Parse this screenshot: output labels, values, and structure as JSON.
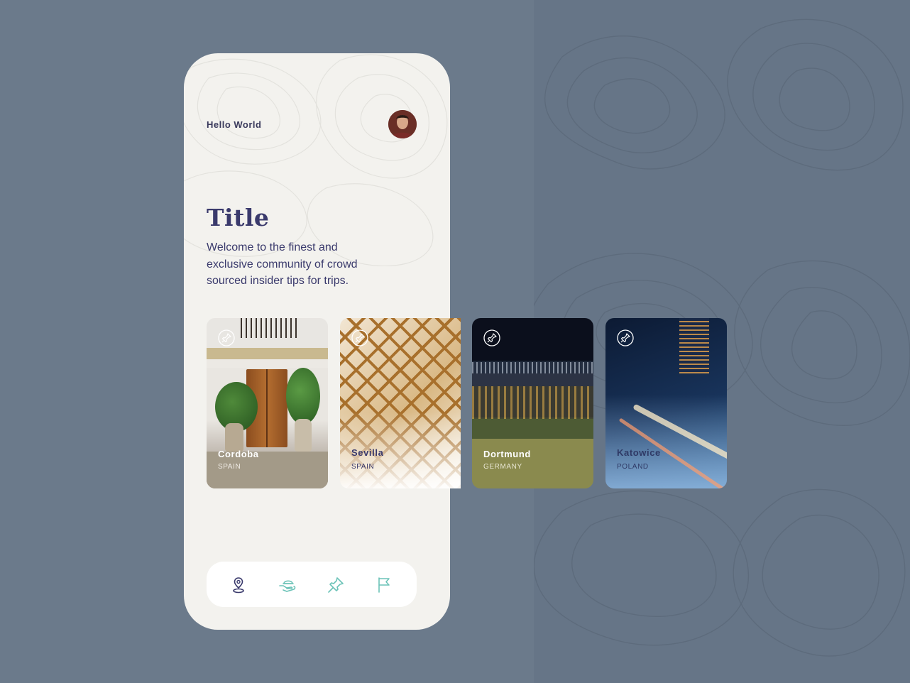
{
  "header": {
    "greeting": "Hello World"
  },
  "hero": {
    "title": "Title",
    "description": "Welcome to the finest and exclusive community of crowd sourced insider tips for trips."
  },
  "cards": [
    {
      "city": "Cordoba",
      "country": "SPAIN"
    },
    {
      "city": "Sevilla",
      "country": "SPAIN"
    },
    {
      "city": "Dortmund",
      "country": "GERMANY"
    },
    {
      "city": "Katowice",
      "country": "POLAND"
    }
  ],
  "bottom_nav": {
    "items": [
      {
        "icon": "map-pin-icon",
        "active": true
      },
      {
        "icon": "hand-offer-icon",
        "active": false
      },
      {
        "icon": "pushpin-icon",
        "active": false
      },
      {
        "icon": "flag-icon",
        "active": false
      }
    ]
  },
  "colors": {
    "background": "#6b7a8b",
    "phone": "#f3f2ee",
    "text_primary": "#3a3a6c",
    "nav_active": "#3a3a6c",
    "nav_inactive": "#6cc3b8"
  }
}
